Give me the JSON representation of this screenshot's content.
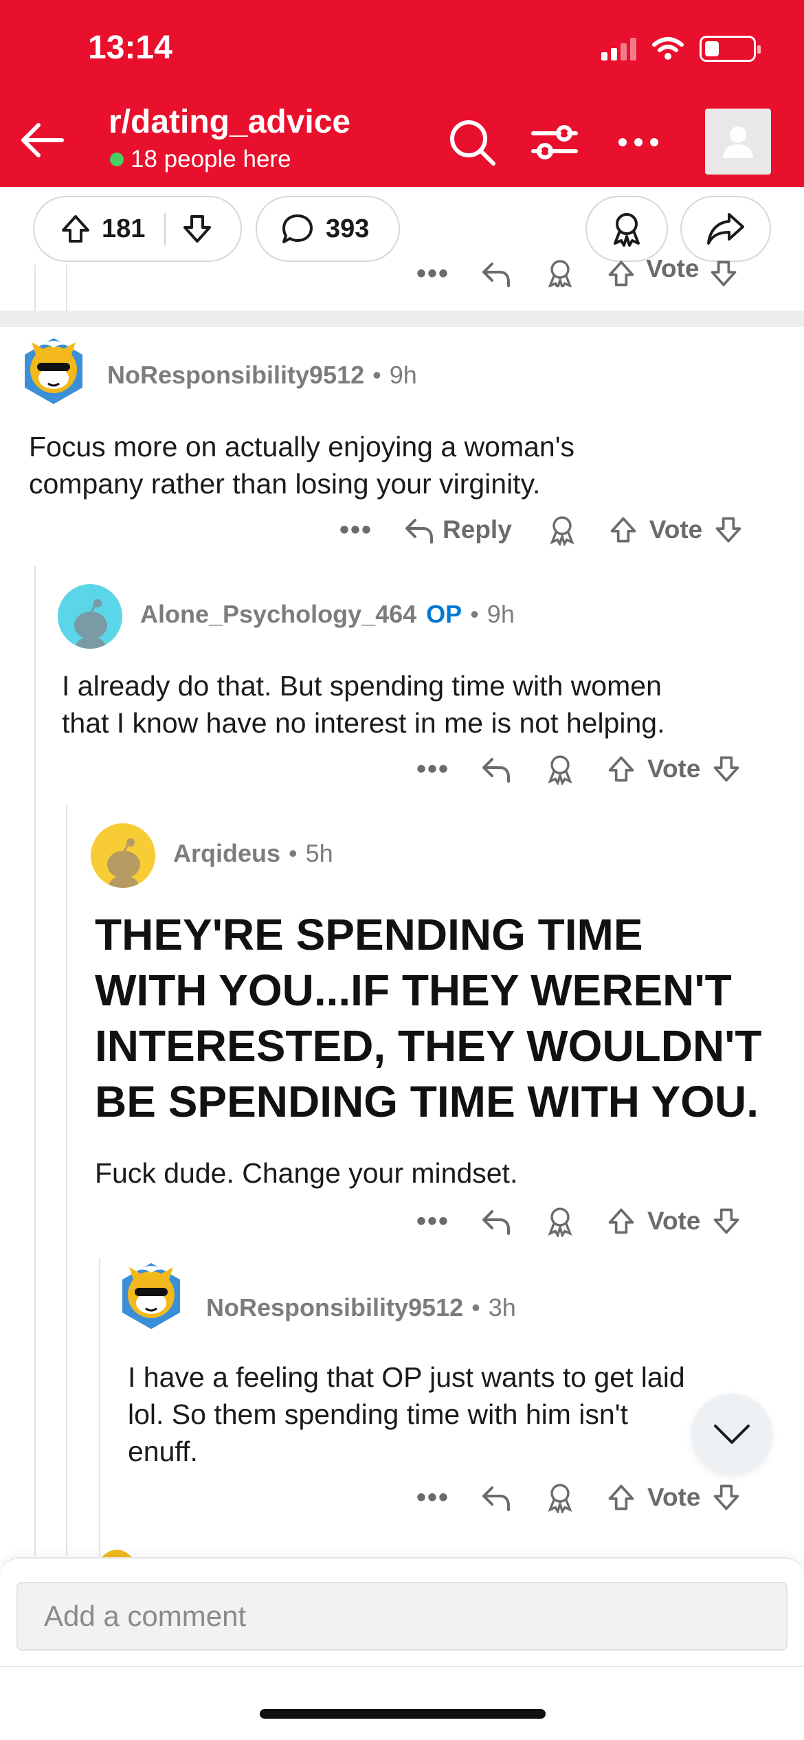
{
  "status_bar": {
    "time": "13:14"
  },
  "header": {
    "subreddit": "r/dating_advice",
    "online_text": "18 people here",
    "icons": [
      "back-arrow-icon",
      "search-icon",
      "filter-icon",
      "more-icon",
      "profile-icon"
    ],
    "accent_color": "#e8102d"
  },
  "post_actions": {
    "upvotes": "181",
    "comments": "393"
  },
  "prev_actions": {
    "vote_label": "Vote"
  },
  "comments": [
    {
      "username": "NoResponsibility9512",
      "age": "9h",
      "body": [
        "Focus more on actually enjoying a woman's",
        "company rather than losing your virginity."
      ],
      "reply_label": "Reply",
      "vote_label": "Vote"
    },
    {
      "username": "Alone_Psychology_464",
      "op_badge": "OP",
      "age": "9h",
      "body": [
        "I already do that. But spending time with women",
        "that I know have no interest in me is not helping."
      ],
      "vote_label": "Vote"
    },
    {
      "username": "Arqideus",
      "age": "5h",
      "heading": [
        "THEY'RE SPENDING TIME",
        "WITH YOU...IF THEY WEREN'T",
        "INTERESTED, THEY WOULDN'T",
        "BE SPENDING TIME WITH YOU."
      ],
      "body": [
        "Fuck dude.  Change your mindset."
      ],
      "vote_label": "Vote"
    },
    {
      "username": "NoResponsibility9512",
      "age": "3h",
      "body": [
        "I have a feeling that OP just wants to get laid",
        "lol. So them spending time with him isn't",
        "enuff."
      ],
      "vote_label": "Vote"
    }
  ],
  "composer": {
    "placeholder": "Add a comment"
  }
}
